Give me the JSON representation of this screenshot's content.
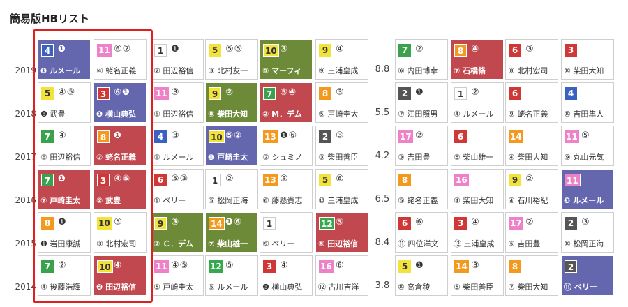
{
  "title": "簡易版HBリスト",
  "colors": {
    "frame": {
      "1": "#ffffff",
      "2": "#333333",
      "3": "#d03838",
      "4": "#2b57b8",
      "5": "#f0e23a",
      "6": "#38a84f",
      "7": "#f39a1e",
      "8": "#ee82c8"
    },
    "hl_blue": "#6467ad",
    "hl_red": "#c0484e",
    "hl_green": "#6c8a38"
  },
  "rows": [
    {
      "year": "2019",
      "odds": "8.8",
      "cells": [
        {
          "f": "4",
          "hl": "hl_blue",
          "m": "❶",
          "j": "❶ ルメール"
        },
        {
          "f": "11",
          "m": "⑥②",
          "j": "④ 蛯名正義"
        },
        {
          "f": "1",
          "m": "❶",
          "j": "② 田辺裕信"
        },
        {
          "f": "5",
          "m": "⑤⑤",
          "j": "③ 北村友一"
        },
        {
          "f": "10",
          "hl": "hl_green",
          "m": "③",
          "j": "⑤ マーフィ"
        },
        {
          "f": "9",
          "m": "④",
          "j": "⑨ 三浦皇成"
        },
        {
          "f": "7",
          "m": "②",
          "j": "⑥ 内田博幸"
        },
        {
          "f": "8",
          "hl": "hl_red",
          "m": "④",
          "j": "⑦ 石橋脩"
        },
        {
          "f": "6",
          "m": "③",
          "j": "⑧ 北村宏司"
        },
        {
          "f": "3",
          "m": "",
          "j": "⑩ 柴田大知"
        }
      ]
    },
    {
      "year": "2018",
      "odds": "5.5",
      "cells": [
        {
          "f": "5",
          "m": "④⑤",
          "j": "❸ 武豊"
        },
        {
          "f": "3",
          "hl": "hl_blue",
          "m": "⑥❶",
          "j": "❶ 横山典弘"
        },
        {
          "f": "11",
          "m": "③",
          "j": "⑥ 田辺裕信"
        },
        {
          "f": "9",
          "hl": "hl_green",
          "m": "②",
          "j": "⑧ 柴田大知"
        },
        {
          "f": "7",
          "hl": "hl_red",
          "m": "⑤④",
          "j": "② M．デム"
        },
        {
          "f": "8",
          "m": "③",
          "j": "⑤ 戸崎圭太"
        },
        {
          "f": "2",
          "m": "❶",
          "j": "⑦ 江田照男"
        },
        {
          "f": "1",
          "m": "②",
          "j": "④ ルメール"
        },
        {
          "f": "6",
          "m": "",
          "j": "⑨ 蛯名正義"
        },
        {
          "f": "4",
          "m": "",
          "j": "⑩ 吉田隼人"
        }
      ]
    },
    {
      "year": "2017",
      "odds": "4.2",
      "cells": [
        {
          "f": "7",
          "m": "④",
          "j": "⑥ 田辺裕信"
        },
        {
          "f": "8",
          "hl": "hl_red",
          "m": "❶",
          "j": "⑦ 蛯名正義"
        },
        {
          "f": "4",
          "m": "③",
          "j": "① ルメール"
        },
        {
          "f": "10",
          "hl": "hl_blue",
          "m": "⑤②",
          "j": "❶ 戸崎圭太"
        },
        {
          "f": "13",
          "m": "❶⑥",
          "j": "② シュミノ"
        },
        {
          "f": "2",
          "m": "③",
          "j": "③ 柴田善臣"
        },
        {
          "f": "17",
          "m": "②",
          "j": "③ 吉田豊"
        },
        {
          "f": "6",
          "m": "",
          "j": "⑤ 柴山雄一"
        },
        {
          "f": "14",
          "m": "",
          "j": "④ 柴田大知"
        },
        {
          "f": "11",
          "m": "⑤",
          "j": "⑨ 丸山元気"
        }
      ]
    },
    {
      "year": "2016",
      "odds": "6.5",
      "cells": [
        {
          "f": "7",
          "hl": "hl_red",
          "m": "❶",
          "j": "⑦ 戸崎圭太"
        },
        {
          "f": "3",
          "hl": "hl_red",
          "m": "④⑤",
          "j": "② 武豊"
        },
        {
          "f": "6",
          "m": "⑤③",
          "j": "① ベリー"
        },
        {
          "f": "1",
          "m": "②",
          "j": "⑤ 松岡正海"
        },
        {
          "f": "13",
          "m": "③",
          "j": "⑥ 藤懸貴志"
        },
        {
          "f": "5",
          "m": "⑥",
          "j": "⑩ 三浦皇成"
        },
        {
          "f": "8",
          "m": "",
          "j": "⑤ 蛯名正義"
        },
        {
          "f": "16",
          "m": "",
          "j": "④ 柴田大知"
        },
        {
          "f": "9",
          "m": "②",
          "j": "④ 石川裕紀"
        },
        {
          "f": "11",
          "hl": "hl_blue",
          "m": "",
          "j": "❸ ルメール"
        }
      ]
    },
    {
      "year": "2015",
      "odds": "8.4",
      "cells": [
        {
          "f": "8",
          "m": "❶",
          "j": "❶ 岩田康誠"
        },
        {
          "f": "10",
          "m": "⑤",
          "j": "③ 北村宏司"
        },
        {
          "f": "9",
          "hl": "hl_green",
          "m": "③",
          "j": "② Ｃ．デム"
        },
        {
          "f": "14",
          "hl": "hl_green",
          "m": "❶⑥",
          "j": "⑦ 柴山雄一"
        },
        {
          "f": "1",
          "m": "",
          "j": "⑨ ベリー"
        },
        {
          "f": "12",
          "hl": "hl_red",
          "m": "⑤",
          "j": "⑤ 田辺裕信"
        },
        {
          "f": "6",
          "m": "⑥",
          "j": "⑪ 四位洋文"
        },
        {
          "f": "3",
          "m": "④",
          "j": "⑫ 三浦皇成"
        },
        {
          "f": "17",
          "m": "②",
          "j": "⑤ 吉田豊"
        },
        {
          "f": "2",
          "m": "③",
          "j": "⑩ 松岡正海"
        }
      ]
    },
    {
      "year": "2014",
      "odds": "3.8",
      "cells": [
        {
          "f": "7",
          "m": "②",
          "j": "④ 後藤浩輝"
        },
        {
          "f": "10",
          "hl": "hl_red",
          "m": "④",
          "j": "❷ 田辺裕信"
        },
        {
          "f": "11",
          "m": "④⑤",
          "j": "⑤ 戸崎圭太"
        },
        {
          "f": "12",
          "m": "⑤",
          "j": "⑤ ルメール"
        },
        {
          "f": "3",
          "m": "④",
          "j": "❸ 横山典弘"
        },
        {
          "f": "16",
          "m": "⑥",
          "j": "⑫ 古川吉洋"
        },
        {
          "f": "5",
          "m": "❶",
          "j": "⑩ 高倉稜"
        },
        {
          "f": "14",
          "m": "③",
          "j": "⑤ 柴田善臣"
        },
        {
          "f": "8",
          "m": "",
          "j": "⑦ 柴田大知"
        },
        {
          "f": "2",
          "hl": "hl_blue",
          "m": "",
          "j": "⑪ ベリー"
        }
      ]
    }
  ]
}
